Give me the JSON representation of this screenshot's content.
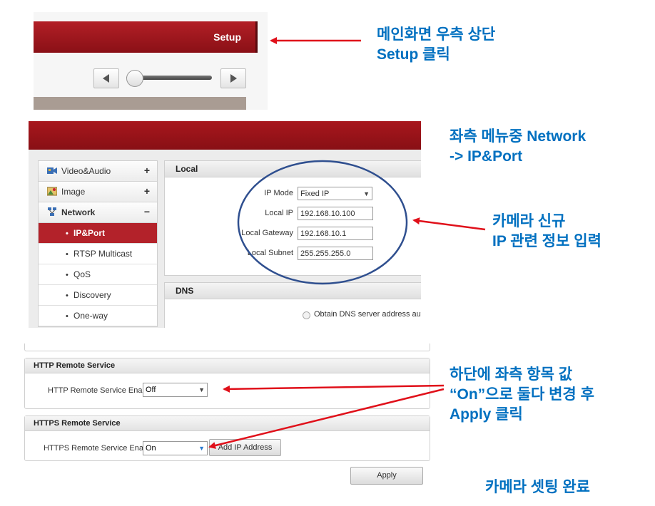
{
  "top_panel": {
    "setup_label": "Setup",
    "prev_icon": "triangle-left-icon",
    "next_icon": "triangle-right-icon"
  },
  "menu": {
    "items": [
      {
        "label": "Video&Audio",
        "sign": "+",
        "icon": "video-audio-icon"
      },
      {
        "label": "Image",
        "sign": "+",
        "icon": "image-icon"
      },
      {
        "label": "Network",
        "sign": "−",
        "icon": "network-icon"
      }
    ],
    "subitems": [
      {
        "bullet": "•",
        "label": "IP&Port"
      },
      {
        "bullet": "•",
        "label": "RTSP Multicast"
      },
      {
        "bullet": "•",
        "label": "QoS"
      },
      {
        "bullet": "•",
        "label": "Discovery"
      },
      {
        "bullet": "•",
        "label": "One-way"
      }
    ]
  },
  "local": {
    "title": "Local",
    "ip_mode_label": "IP Mode",
    "ip_mode_value": "Fixed IP",
    "local_ip_label": "Local IP",
    "local_ip_value": "192.168.10.100",
    "gateway_label": "Local Gateway",
    "gateway_value": "192.168.10.1",
    "subnet_label": "Local Subnet",
    "subnet_value": "255.255.255.0"
  },
  "dns": {
    "title": "DNS",
    "obtain_label": "Obtain DNS server address aut"
  },
  "http": {
    "title": "HTTP Remote Service",
    "enable_label": "HTTP Remote Service Enable",
    "enable_value": "Off"
  },
  "https": {
    "title": "HTTPS Remote Service",
    "enable_label": "HTTPS Remote Service Enable",
    "enable_value": "On",
    "add_ip_label": "Add IP Address"
  },
  "apply_label": "Apply",
  "annotations": {
    "n1_line1": "메인화면 우측 상단",
    "n1_line2": "Setup 클릭",
    "n2_line1": "좌측 메뉴중 Network",
    "n2_line2": "-> IP&Port",
    "n3_line1": "카메라 신규",
    "n3_line2": "IP 관련 정보 입력",
    "n4_line1": "하단에 좌측 항목 값",
    "n4_line2": "“On”으로 둘다 변경 후",
    "n4_line3": "Apply 클릭",
    "n5": "카메라 셋팅 완료"
  },
  "colors": {
    "brand_red": "#b3222a",
    "annotation_blue": "#0070c0",
    "arrow_red": "#e0101a",
    "ellipse_blue": "#2f4f8f"
  }
}
